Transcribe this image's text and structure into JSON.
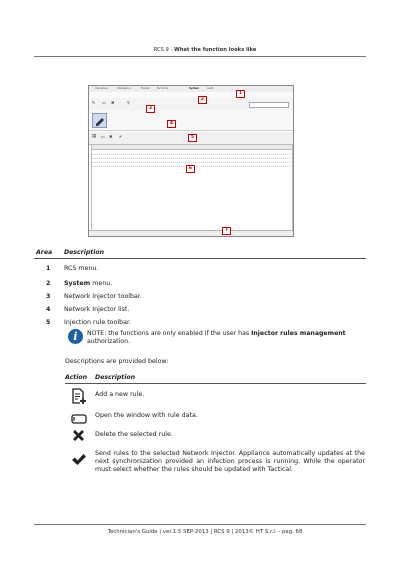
{
  "header": {
    "product": "RCS 9",
    "separator": " - ",
    "title": "What the function looks like"
  },
  "screenshot": {
    "menu_items": [
      "Operations",
      "Intelligence",
      "Monitor",
      "Technical",
      "System",
      "Audit"
    ],
    "callouts": [
      "1",
      "2",
      "3",
      "4",
      "5",
      "6",
      "7"
    ]
  },
  "area_table": {
    "col_area": "Area",
    "col_description": "Description",
    "rows": [
      {
        "n": "1",
        "text": "RCS menu."
      },
      {
        "n": "2",
        "bold": "System",
        "text": " menu."
      },
      {
        "n": "3",
        "text": "Network Injector toolbar."
      },
      {
        "n": "4",
        "text": "Network Injector list."
      },
      {
        "n": "5",
        "text": "Injection rule toolbar."
      }
    ]
  },
  "note": {
    "prefix": "NOTE: the functions are only enabled if the user has ",
    "bold": "Injector rules management",
    "suffix": " authorization."
  },
  "descriptions_intro": "Descriptions are provided below:",
  "action_table": {
    "col_action": "Action",
    "col_description": "Description",
    "rows": [
      {
        "icon": "add-rule-icon",
        "text": "Add a new rule."
      },
      {
        "icon": "edit-rule-icon",
        "text": "Open the window with rule data."
      },
      {
        "icon": "delete-icon",
        "text": "Delete the selected rule."
      },
      {
        "icon": "checkmark-icon",
        "text": "Send rules to the selected Network Injector. Appliance automatically updates at the next synchronization provided an infection process is running. While the operator must select whether the rules should be updated with Tactical."
      }
    ]
  },
  "footer": {
    "text": "Technician's Guide | ver.1.5 SEP-2013 | RCS 9 | 2013© HT S.r.l. - pag. 68"
  }
}
